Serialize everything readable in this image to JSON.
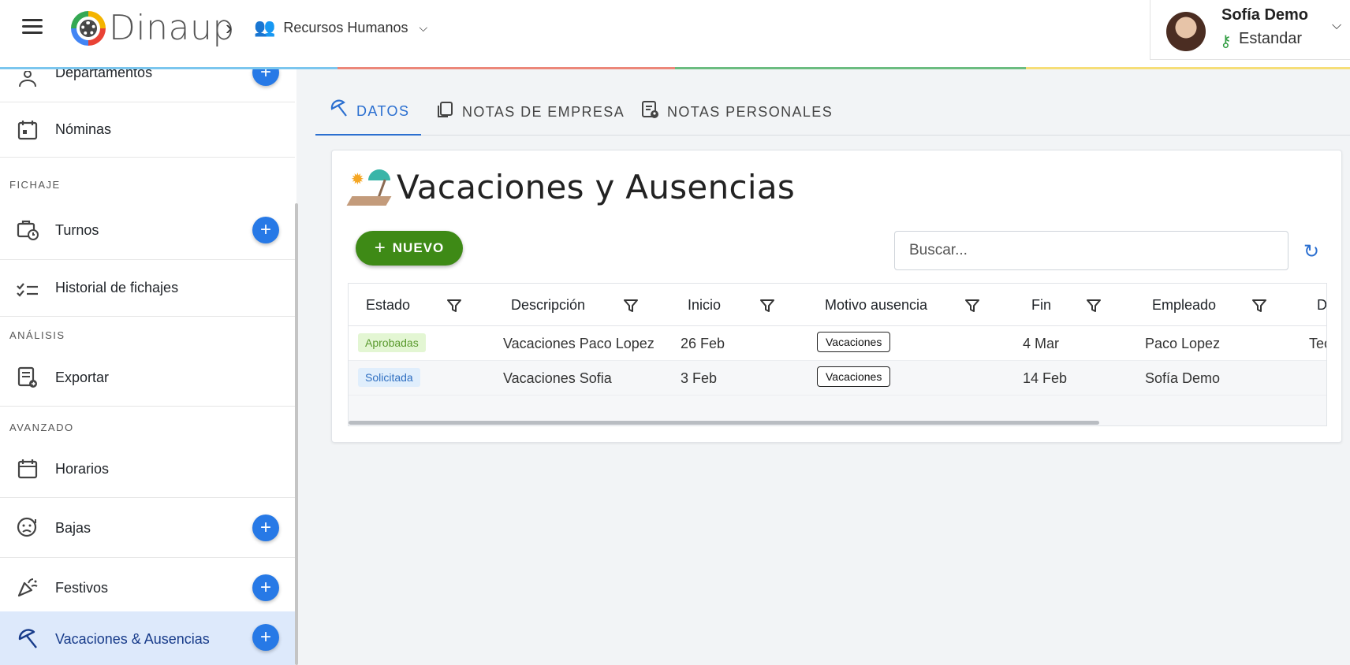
{
  "header": {
    "brand": "Dinaup",
    "breadcrumb_sep": "›",
    "module": "Recursos Humanos",
    "user_name": "Sofía Demo",
    "user_role": "Estandar"
  },
  "sidebar": {
    "items": [
      {
        "label": "Departamentos",
        "icon": "group-icon"
      },
      {
        "label": "Nóminas",
        "icon": "calendar-icon"
      },
      {
        "label": "Turnos",
        "icon": "briefcase-clock-icon"
      },
      {
        "label": "Historial de fichajes",
        "icon": "checklist-icon"
      },
      {
        "label": "Exportar",
        "icon": "export-doc-icon"
      },
      {
        "label": "Horarios",
        "icon": "calendar-icon"
      },
      {
        "label": "Bajas",
        "icon": "sick-face-icon"
      },
      {
        "label": "Festivos",
        "icon": "party-popper-icon"
      },
      {
        "label": "Vacaciones & Ausencias",
        "icon": "beach-umbrella-icon"
      }
    ],
    "sections": [
      "FICHAJE",
      "ANÁLISIS",
      "AVANZADO"
    ],
    "add_label": "+"
  },
  "tabs": [
    {
      "label": "DATOS",
      "active": true
    },
    {
      "label": "NOTAS DE EMPRESA",
      "active": false
    },
    {
      "label": "NOTAS PERSONALES",
      "active": false
    }
  ],
  "main": {
    "title": "Vacaciones y Ausencias",
    "new_button": "NUEVO",
    "search_placeholder": "Buscar..."
  },
  "table": {
    "columns": [
      "Estado",
      "Descripción",
      "Inicio",
      "Motivo ausencia",
      "Fin",
      "Empleado",
      "D"
    ],
    "rows": [
      {
        "estado": "Aprobadas",
        "descripcion": "Vacaciones Paco Lopez",
        "inicio": "26 Feb",
        "motivo": "Vacaciones",
        "fin": "4 Mar",
        "empleado": "Paco Lopez",
        "extra": "Tec"
      },
      {
        "estado": "Solicitada",
        "descripcion": "Vacaciones Sofia",
        "inicio": "3 Feb",
        "motivo": "Vacaciones",
        "fin": "14 Feb",
        "empleado": "Sofía Demo",
        "extra": ""
      }
    ]
  },
  "colors": {
    "accent": "#2779e6",
    "new_button": "#3e8a16",
    "active_tab": "#2b6fd0",
    "active_nav": "#dde9fb"
  }
}
